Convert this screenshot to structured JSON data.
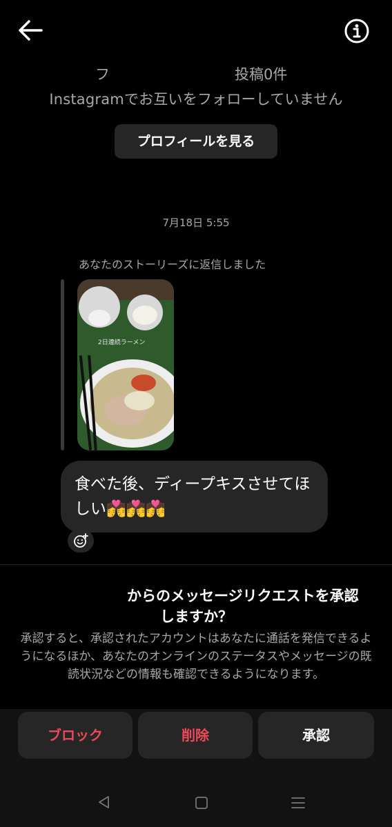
{
  "header": {
    "back_icon": "arrow-left-icon",
    "info_icon": "info-icon"
  },
  "profile": {
    "name_fragment": "フ",
    "posts": "投稿0件",
    "follow_status": "Instagramでお互いをフォローしていません",
    "view_profile_label": "プロフィールを見る"
  },
  "conversation": {
    "timestamp": "7月18日 5:55",
    "story_reply_note": "あなたのストーリーズに返信しました",
    "story_caption": "2日連続ラーメン",
    "message": "食べた後、ディープキスさせてほしい💏💏💏",
    "reaction_icon": "emoji-add-icon"
  },
  "request": {
    "title_line1": "からのメッセージリクエストを承認",
    "title_line2": "しますか？",
    "description": "承認すると、承認されたアカウントはあなたに通話を発信できるようになるほか、あなたのオンラインのステータスやメッセージの既読状況などの情報も確認できるようになります。"
  },
  "actions": {
    "block_label": "ブロック",
    "delete_label": "削除",
    "accept_label": "承認"
  },
  "colors": {
    "background": "#000000",
    "surface": "#262626",
    "muted_text": "#a8a8a8",
    "danger": "#ed4956"
  }
}
